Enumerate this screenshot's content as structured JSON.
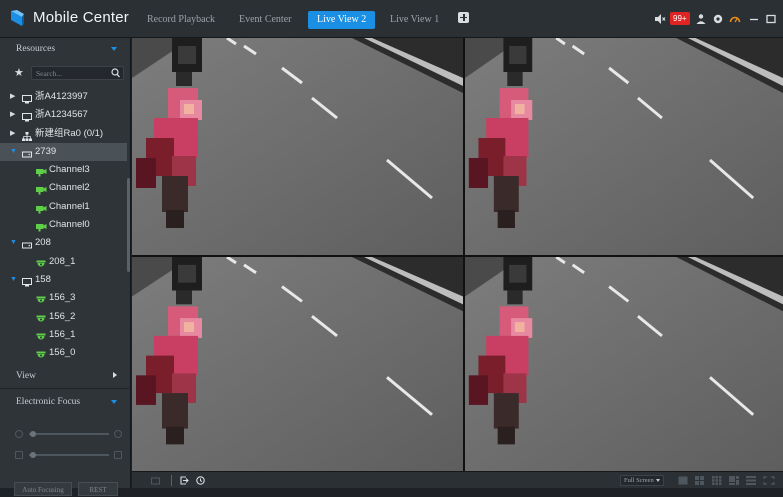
{
  "app": {
    "title": "Mobile Center"
  },
  "tabs": [
    {
      "label": "Record Playback",
      "active": false
    },
    {
      "label": "Event Center",
      "active": false
    },
    {
      "label": "Live View 2",
      "active": true
    },
    {
      "label": "Live View 1",
      "active": false
    }
  ],
  "topbar": {
    "alarm_badge": "99+"
  },
  "sidebar": {
    "resources_header": "Resources",
    "search_placeholder": "Search...",
    "tree": [
      {
        "label": "浙A4123997",
        "icon": "device-icon",
        "level": 0,
        "expanded": false
      },
      {
        "label": "浙A1234567",
        "icon": "device-icon",
        "level": 0,
        "expanded": false
      },
      {
        "label": "新建组Ra0 (0/1)",
        "icon": "org-icon",
        "level": 0,
        "expanded": false
      },
      {
        "label": "2739",
        "icon": "nvr-icon",
        "level": 0,
        "expanded": true,
        "selected": true
      },
      {
        "label": "Channel3",
        "icon": "camera-icon",
        "level": 1
      },
      {
        "label": "Channel2",
        "icon": "camera-icon",
        "level": 1
      },
      {
        "label": "Channel1",
        "icon": "camera-icon",
        "level": 1
      },
      {
        "label": "Channel0",
        "icon": "camera-icon",
        "level": 1
      },
      {
        "label": "208",
        "icon": "nvr-icon",
        "level": 0,
        "expanded": true
      },
      {
        "label": "208_1",
        "icon": "dome-camera-icon",
        "level": 1
      },
      {
        "label": "158",
        "icon": "device-icon",
        "level": 0,
        "expanded": true
      },
      {
        "label": "156_3",
        "icon": "dome-camera-icon",
        "level": 1
      },
      {
        "label": "156_2",
        "icon": "dome-camera-icon",
        "level": 1
      },
      {
        "label": "156_1",
        "icon": "dome-camera-icon",
        "level": 1
      },
      {
        "label": "156_0",
        "icon": "dome-camera-icon",
        "level": 1
      }
    ],
    "view_header": "View",
    "focus_header": "Electronic Focus",
    "auto_focusing": "Auto Focusing",
    "reset": "REST"
  },
  "bottombar": {
    "fullscreen_label": "Full Screen"
  },
  "colors": {
    "accent": "#1a8fe3",
    "alarm": "#e02323",
    "panel": "#2f3439",
    "topbar": "#2b3035"
  }
}
